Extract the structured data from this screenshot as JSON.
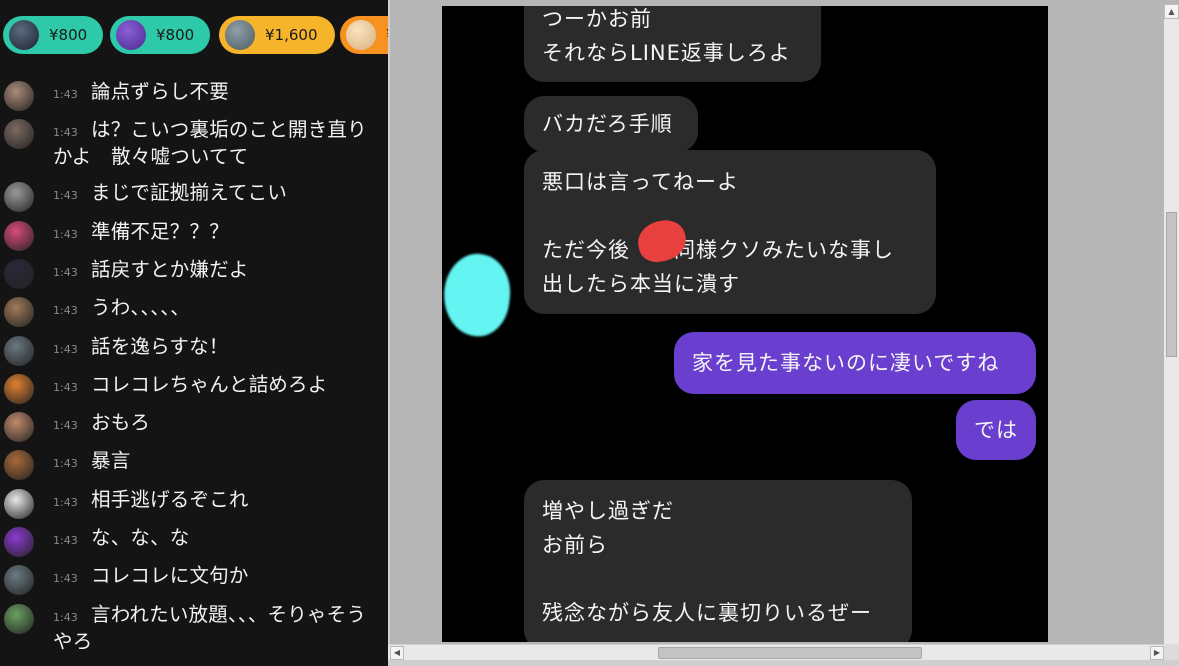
{
  "super_chats": [
    {
      "amount": "¥800"
    },
    {
      "amount": "¥800"
    },
    {
      "amount": "¥1,600"
    },
    {
      "amount": "¥"
    }
  ],
  "chat": {
    "messages": [
      {
        "time": "1:43",
        "text": "論点ずらし不要",
        "avatar_color": "#a98a7a"
      },
      {
        "time": "1:43",
        "text": "は？こいつ裏垢のこと開き直りかよ　散々嘘ついてて",
        "avatar_color": "#7c6a60"
      },
      {
        "time": "1:43",
        "text": "まじで証拠揃えてこい",
        "avatar_color": "#9a9a9a"
      },
      {
        "time": "1:43",
        "text": "準備不足？？？",
        "avatar_color": "#d84a7c"
      },
      {
        "time": "1:43",
        "text": "話戻すとか嫌だよ",
        "avatar_color": "#2a2838"
      },
      {
        "time": "1:43",
        "text": "うわ、、、、、",
        "avatar_color": "#a07a5a"
      },
      {
        "time": "1:43",
        "text": "話を逸らすな！",
        "avatar_color": "#6a7880"
      },
      {
        "time": "1:43",
        "text": "コレコレちゃんと詰めろよ",
        "avatar_color": "#e08030"
      },
      {
        "time": "1:43",
        "text": "おもろ",
        "avatar_color": "#c08a6a"
      },
      {
        "time": "1:43",
        "text": "暴言",
        "avatar_color": "#a86a3a"
      },
      {
        "time": "1:43",
        "text": "相手逃げるぞこれ",
        "avatar_color": "#e8e8e8"
      },
      {
        "time": "1:43",
        "text": "な、な、な",
        "avatar_color": "#8a3ad0"
      },
      {
        "time": "1:43",
        "text": "コレコレに文句か",
        "avatar_color": "#6a7a82"
      },
      {
        "time": "1:43",
        "text": "言われたい放題、、、そりゃそうやろ",
        "avatar_color": "#6aa060"
      }
    ]
  },
  "line_chat": {
    "bubbles": [
      {
        "side": "in",
        "text": "つーかお前\nそれならLINE返事しろよ"
      },
      {
        "side": "in",
        "text": "バカだろ手順"
      },
      {
        "side": "in",
        "text": "悪口は言ってねーよ\n\nただ今後　　同様クソみたいな事し\n出したら本当に潰す"
      },
      {
        "side": "out",
        "text": "家を見た事ないのに凄いですね"
      },
      {
        "side": "out",
        "text": "では"
      },
      {
        "side": "in",
        "text": "増やし過ぎだ\nお前ら\n\n残念ながら友人に裏切りいるぜー"
      }
    ]
  }
}
